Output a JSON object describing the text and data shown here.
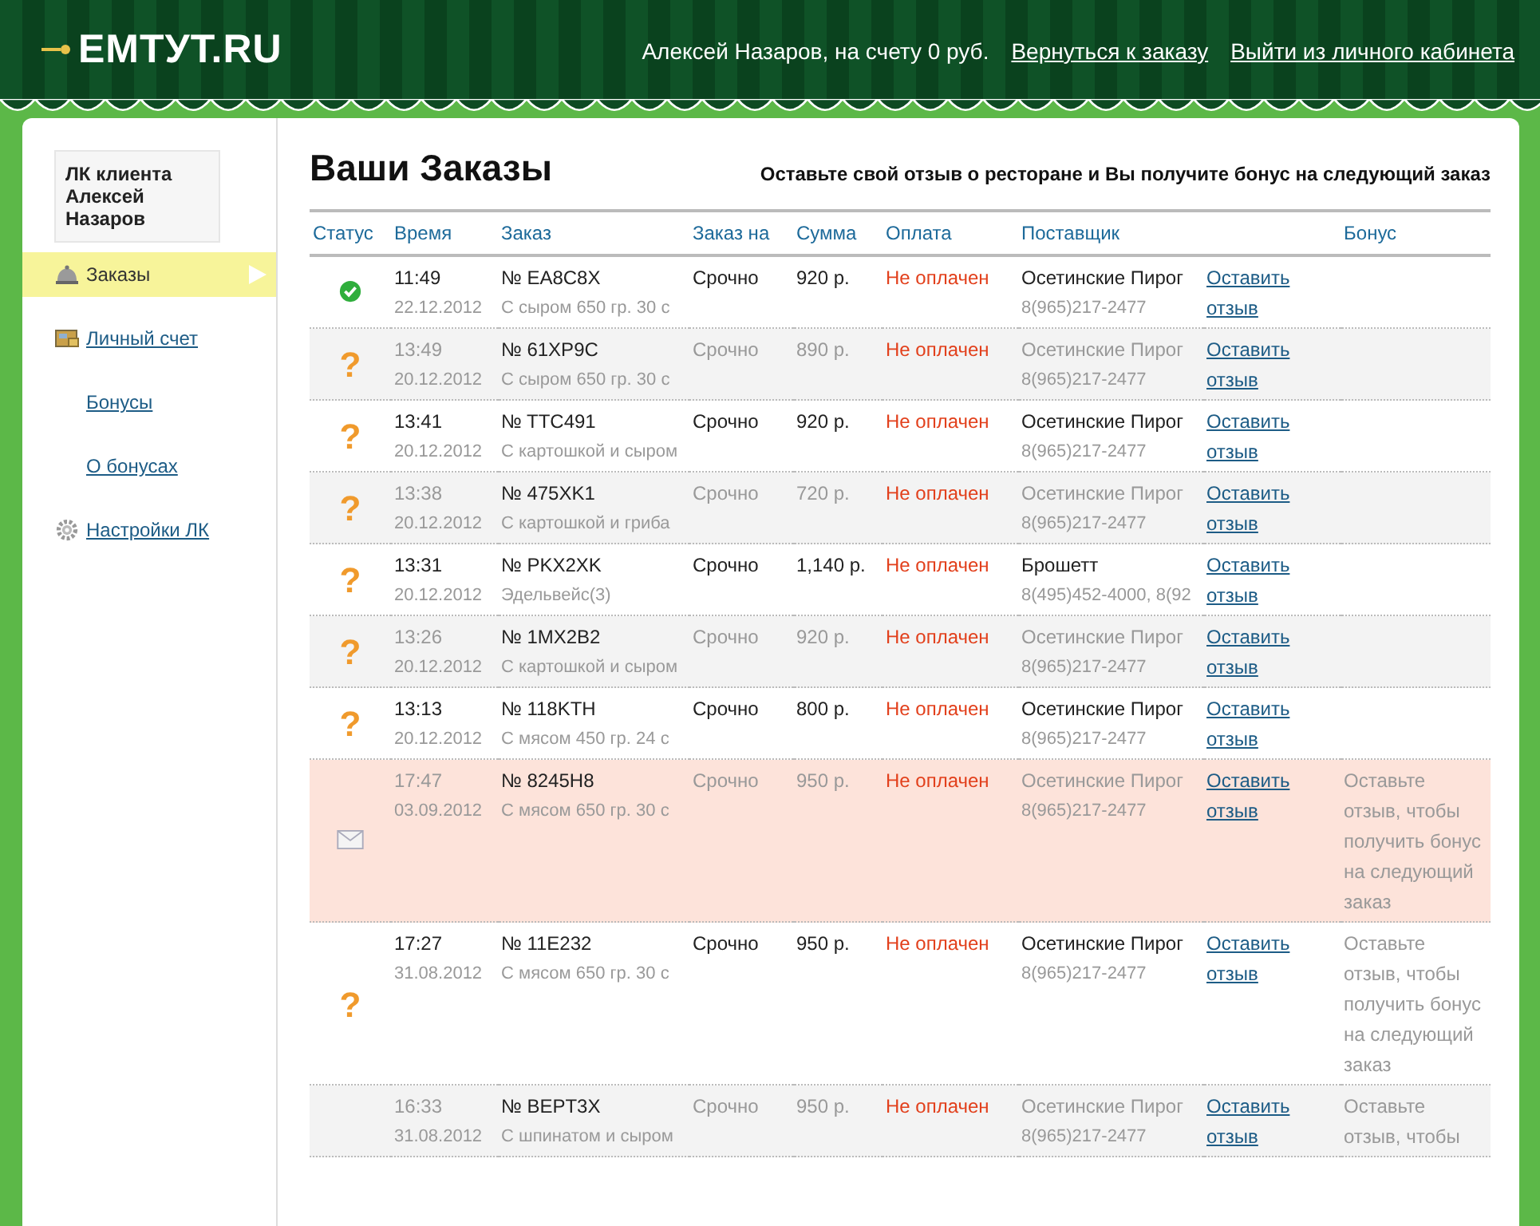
{
  "header": {
    "logo": "ЕМТУТ.RU",
    "user_info": "Алексей Назаров, на счету 0 руб.",
    "links": [
      "Вернуться к заказу",
      "Выйти из личного кабинета"
    ]
  },
  "sidebar": {
    "client_card": "ЛК клиента Алексей Назаров",
    "items": [
      {
        "label": "Заказы",
        "selected": true
      },
      {
        "label": "Личный счет",
        "selected": false,
        "children": [
          {
            "label": "Бонусы",
            "selected": false
          },
          {
            "label": "О бонусах",
            "selected": false
          }
        ]
      },
      {
        "label": "Настройки ЛК",
        "selected": false
      }
    ]
  },
  "main": {
    "title": "Ваши Заказы",
    "promo": "Оставьте свой отзыв о ресторане и Вы получите бонус на следующий заказ"
  },
  "table": {
    "columns": [
      "Статус",
      "Время",
      "Заказ",
      "Заказ на",
      "Сумма",
      "Оплата",
      "Поставщик",
      "Бонус"
    ],
    "rows": [
      {
        "kind": "done",
        "muted": false,
        "highlighted": false,
        "time": "11:49",
        "date": "22.12.2012",
        "order": "№ EA8C8X",
        "items": "С сыром 650 гр. 30 с",
        "when": "Срочно",
        "sum": "920 р.",
        "payment": "Не оплачен",
        "supplier": "Осетинские Пирог",
        "phone": "8(965)217-2477",
        "review_link": "Оставить отзыв"
      },
      {
        "kind": "pending",
        "status_mark": "?",
        "muted": true,
        "highlighted": false,
        "time": "13:49",
        "date": "20.12.2012",
        "order": "№ 61XP9C",
        "items": "С сыром 650 гр. 30 с",
        "when": "Срочно",
        "sum": "890 р.",
        "payment": "Не оплачен",
        "supplier": "Осетинские Пирог",
        "phone": "8(965)217-2477",
        "review_link": "Оставить отзыв"
      },
      {
        "kind": "pending",
        "status_mark": "?",
        "muted": false,
        "highlighted": false,
        "time": "13:41",
        "date": "20.12.2012",
        "order": "№ TTC491",
        "items": "С картошкой и сыром",
        "when": "Срочно",
        "sum": "920 р.",
        "payment": "Не оплачен",
        "supplier": "Осетинские Пирог",
        "phone": "8(965)217-2477",
        "review_link": "Оставить отзыв"
      },
      {
        "kind": "pending",
        "status_mark": "?",
        "muted": true,
        "highlighted": false,
        "time": "13:38",
        "date": "20.12.2012",
        "order": "№ 475XK1",
        "items": "С картошкой и гриба",
        "when": "Срочно",
        "sum": "720 р.",
        "payment": "Не оплачен",
        "supplier": "Осетинские Пирог",
        "phone": "8(965)217-2477",
        "review_link": "Оставить отзыв"
      },
      {
        "kind": "pending",
        "status_mark": "?",
        "muted": false,
        "highlighted": false,
        "time": "13:31",
        "date": "20.12.2012",
        "order": "№ PKX2XK",
        "items": "Эдельвейс(3)",
        "when": "Срочно",
        "sum": "1,140 р.",
        "payment": "Не оплачен",
        "supplier": "Брошетт",
        "phone": "8(495)452-4000, 8(92",
        "review_link": "Оставить отзыв"
      },
      {
        "kind": "pending",
        "status_mark": "?",
        "muted": true,
        "highlighted": false,
        "time": "13:26",
        "date": "20.12.2012",
        "order": "№ 1MX2B2",
        "items": "С картошкой и сыром",
        "when": "Срочно",
        "sum": "920 р.",
        "payment": "Не оплачен",
        "supplier": "Осетинские Пирог",
        "phone": "8(965)217-2477",
        "review_link": "Оставить отзыв"
      },
      {
        "kind": "pending",
        "status_mark": "?",
        "muted": false,
        "highlighted": false,
        "time": "13:13",
        "date": "20.12.2012",
        "order": "№ 118KTH",
        "items": "С мясом 450 гр. 24 с",
        "when": "Срочно",
        "sum": "800 р.",
        "payment": "Не оплачен",
        "supplier": "Осетинские Пирог",
        "phone": "8(965)217-2477",
        "review_link": "Оставить отзыв"
      },
      {
        "kind": "message",
        "muted": true,
        "highlighted": true,
        "time": "17:47",
        "date": "03.09.2012",
        "order": "№ 8245H8",
        "items": "С мясом 650 гр. 30 с",
        "when": "Срочно",
        "sum": "950 р.",
        "payment": "Не оплачен",
        "supplier": "Осетинские Пирог",
        "phone": "8(965)217-2477",
        "review_link": "Оставить отзыв",
        "bonus": "Оставьте отзыв, чтобы получить бонус на следующий заказ"
      },
      {
        "kind": "pending",
        "status_mark": "?",
        "muted": false,
        "highlighted": false,
        "time": "17:27",
        "date": "31.08.2012",
        "order": "№ 11E232",
        "items": "С мясом 650 гр. 30 с",
        "when": "Срочно",
        "sum": "950 р.",
        "payment": "Не оплачен",
        "supplier": "Осетинские Пирог",
        "phone": "8(965)217-2477",
        "review_link": "Оставить отзыв",
        "bonus": "Оставьте отзыв, чтобы получить бонус на следующий заказ"
      },
      {
        "kind": "none",
        "muted": true,
        "highlighted": false,
        "time": "16:33",
        "date": "31.08.2012",
        "order": "№ BEPT3X",
        "items": "С шпинатом и сыром",
        "when": "Срочно",
        "sum": "950 р.",
        "payment": "Не оплачен",
        "supplier": "Осетинские Пирог",
        "phone": "8(965)217-2477",
        "review_link": "Оставить отзыв",
        "bonus": "Оставьте отзыв, чтобы"
      }
    ]
  }
}
